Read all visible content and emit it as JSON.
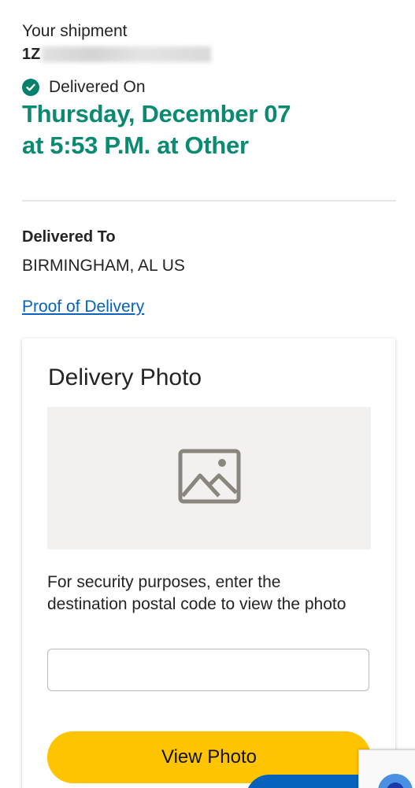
{
  "shipment": {
    "label": "Your shipment",
    "tracking_prefix": "1Z"
  },
  "status": {
    "label": "Delivered On",
    "date_line1": "Thursday, December 07",
    "date_line2": "at 5:53 P.M. at Other"
  },
  "delivered_to": {
    "label": "Delivered To",
    "location": "BIRMINGHAM, AL US"
  },
  "proof_link": "Proof of Delivery",
  "photo_card": {
    "title": "Delivery Photo",
    "description": "For security purposes, enter the destination postal code to view the photo",
    "input_placeholder": "",
    "button_label": "View Photo"
  },
  "colors": {
    "accent_green": "#0a8a71",
    "link_blue": "#0662bb",
    "button_yellow": "#ffc400"
  },
  "icons": {
    "status": "check-circle-icon",
    "photo": "image-placeholder-icon"
  }
}
